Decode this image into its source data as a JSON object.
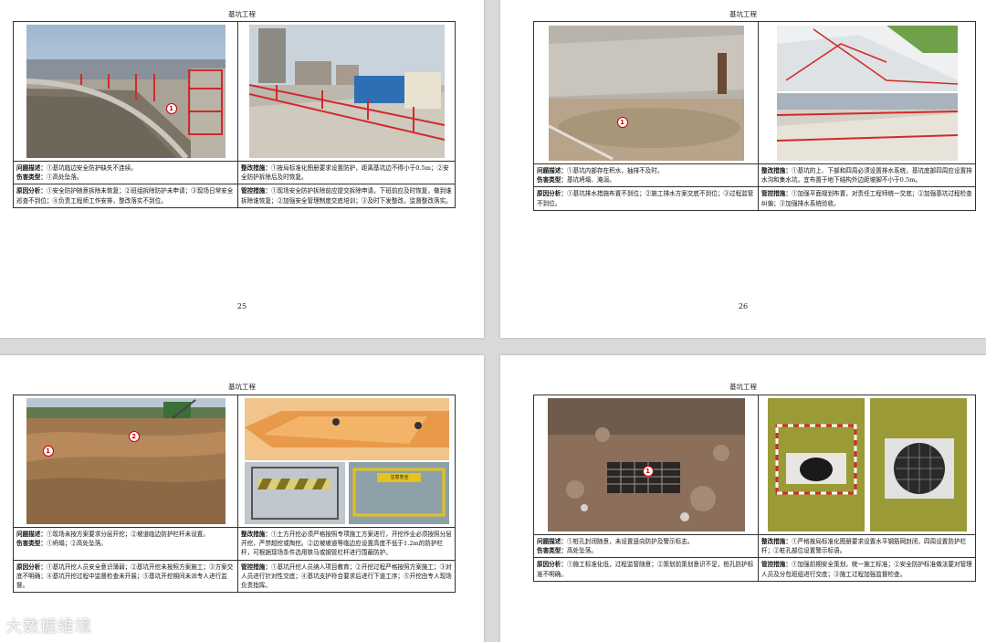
{
  "pages": [
    {
      "title": "基坑工程",
      "page_number": "25",
      "photo_markers": [
        "1"
      ],
      "problem_label": "问题描述：",
      "problem_text": "①基坑临边安全防护缺失不连续。",
      "hazard_label": "伤害类型：",
      "hazard_text": "①高处坠落。",
      "fix_label": "整改措施：",
      "fix_text": "①按局标准化图册要求设置防护，距离基坑边不得小于0.5m；②安全防护拆除后及时恢复。",
      "cause_label": "原因分析：",
      "cause_text": "①安全防护随意拆除未恢复；②班组拆除防护未申请；③现场日常安全巡查不到位；④负责工程师工作安排，整改落实不到位。",
      "control_label": "管控措施：",
      "control_text": "①现场安全防护拆除前应提交拆除申请，下班前应及时恢复，做到谁拆除谁恢复；②加强安全管理制度交底培训；③及时下发整改，监督整改落实。"
    },
    {
      "title": "基坑工程",
      "page_number": "26",
      "photo_markers": [
        "1"
      ],
      "problem_label": "问题描述：",
      "problem_text": "①基坑内部存在积水，抽排不及时。",
      "hazard_label": "伤害类型：",
      "hazard_text": "基坑坍塌、淹溺。",
      "fix_label": "整改措施：",
      "fix_text": "①基坑的上、下部和四周必须设置排水系统，基坑底部四周应设置排水沟和集水坑，宜布置于地下结构外边距坡脚不小于0.5m。",
      "cause_label": "原因分析：",
      "cause_text": "①基坑排水措施布置不到位；②施工排水方案交底不到位；③过程监管不到位。",
      "control_label": "管控措施：",
      "control_text": "①加强平面规划布置，对责任工程师统一交底；②加强基坑过程检查纠偏；③加强排水系统验收。"
    },
    {
      "title": "基坑工程",
      "photo_markers": [
        "1",
        "2"
      ],
      "barrier_sign": "注意安全",
      "problem_label": "问题描述：",
      "problem_text": "①现场未按方案要求分层开挖；②坡道临边防护栏杆未设置。",
      "hazard_label": "伤害类型：",
      "hazard_text": "①坍塌；②高处坠落。",
      "fix_label": "整改措施：",
      "fix_text": "①土方开挖必须严格按照专项施工方案进行，开挖作业必须按照分层开挖，严禁超挖或掏挖。②边坡坡道等临边应设置高度不低于1.2m的防护栏杆，可根据现场条件选用铁马或钢管栏杆进行围蔽防护。",
      "cause_label": "原因分析：",
      "cause_text": "①基坑开挖人员安全意识薄弱；②基坑开挖未按照方案施工；③方案交底不明确；④基坑开挖过程中监督检查未开展；⑤基坑开挖期间未派专人进行监督。",
      "control_label": "管控措施：",
      "control_text": "①基坑开挖人员纳入项目教育；②开挖过程严格按照方案施工；③对人员进行针对性交底；④基坑支护符合要求后进行下道工序；⑤开挖由专人现场负责指挥。"
    },
    {
      "title": "基坑工程",
      "photo_markers": [
        "1"
      ],
      "problem_label": "问题描述：",
      "problem_text": "①桩孔封闭随意，未设置竖向防护及警示标志。",
      "hazard_label": "伤害类型：",
      "hazard_text": "高处坠落。",
      "fix_label": "整改措施：",
      "fix_text": "①严格按局标准化图册要求设置水平钢筋网封闭，四周设置防护栏杆；②桩孔部位设置警示标语。",
      "cause_label": "原因分析：",
      "cause_text": "①施工标准化低，过程监管随意；②策划前策划意识不足，桩孔防护标准不明确。",
      "control_label": "管控措施：",
      "control_text": "①加强前期安全策划，统一施工标准；②安全防护标准做法要对管理人员及分包班组进行交底；③施工过程加强监督检查。"
    }
  ],
  "watermark": "大数据维境"
}
